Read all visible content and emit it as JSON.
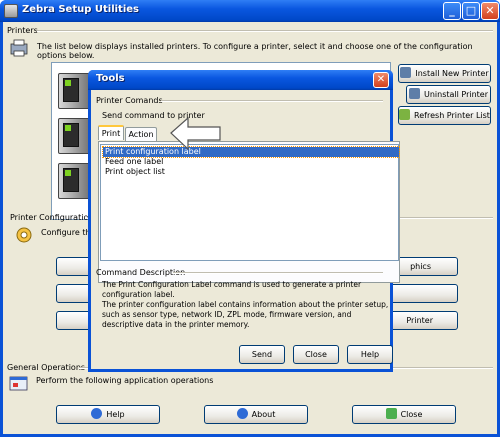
{
  "main": {
    "title": "Zebra Setup Utilities",
    "printers_group": "Printers",
    "printers_desc": "The list below displays installed printers. To configure a printer, select it and choose one of the configuration options below.",
    "buttons": {
      "install": "Install New Printer",
      "uninstall": "Uninstall Printer",
      "refresh": "Refresh Printer List"
    },
    "config_group": "Printer Configuration",
    "config_desc": "Configure the",
    "config_btn_graphics": "phics",
    "config_btn_printer": "Printer",
    "general_group": "General Operations",
    "general_desc": "Perform the following application operations",
    "help": "Help",
    "about": "About",
    "close": "Close"
  },
  "dialog": {
    "title": "Tools",
    "section": "Printer Comands",
    "subtitle": "Send command to printer",
    "tabs": [
      "Print",
      "Action"
    ],
    "commands": [
      "Print configuration label",
      "Feed one label",
      "Print object list"
    ],
    "desc_title": "Command Description",
    "desc_line1": "The Print Configuration Label command is used to generate a printer configuration label.",
    "desc_line2": "The printer configuration label contains information about the printer setup, such as sensor type, network ID, ZPL mode, firmware version, and descriptive data in the printer memory.",
    "send": "Send",
    "close": "Close",
    "help": "Help",
    "close_x": "✕"
  },
  "window_controls": {
    "minimize": "_",
    "maximize": "□",
    "close": "✕"
  },
  "colors": {
    "titlebar": "#0a52d6",
    "window_bg": "#ece9d8",
    "selection": "#316ac5"
  }
}
